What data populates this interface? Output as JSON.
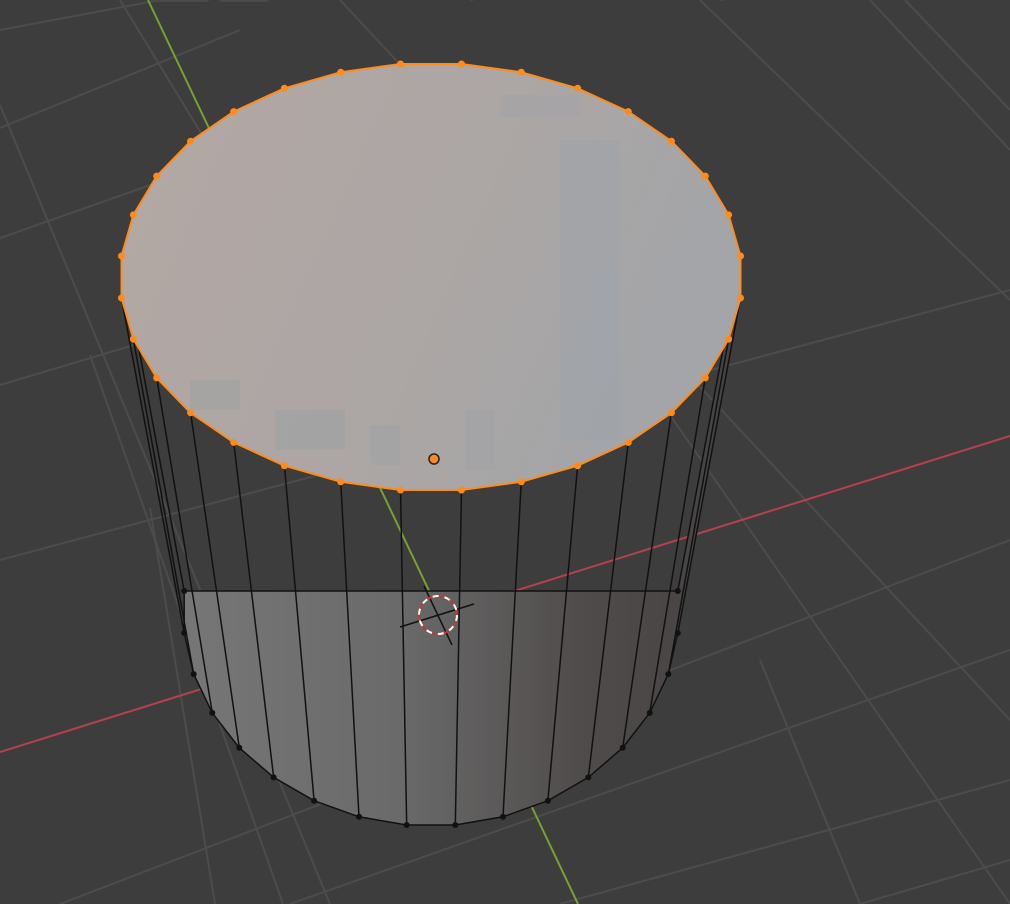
{
  "viewport": {
    "background_color": "#3d3d3d",
    "grid_color": "#4c4c4c",
    "x_axis_color": "#b5414e",
    "y_axis_color": "#78a032"
  },
  "mesh": {
    "object": "cylinder",
    "segments": 32,
    "mode": "edit",
    "selection": "top-face",
    "selected_color": "#ff8c1a",
    "face_color": "#a8a4a2",
    "side_color": "#6a6a6a",
    "edge_color": "#111111"
  },
  "cursor": {
    "name": "3d-cursor",
    "ring_colors": [
      "#cc3333",
      "#ffffff"
    ]
  }
}
